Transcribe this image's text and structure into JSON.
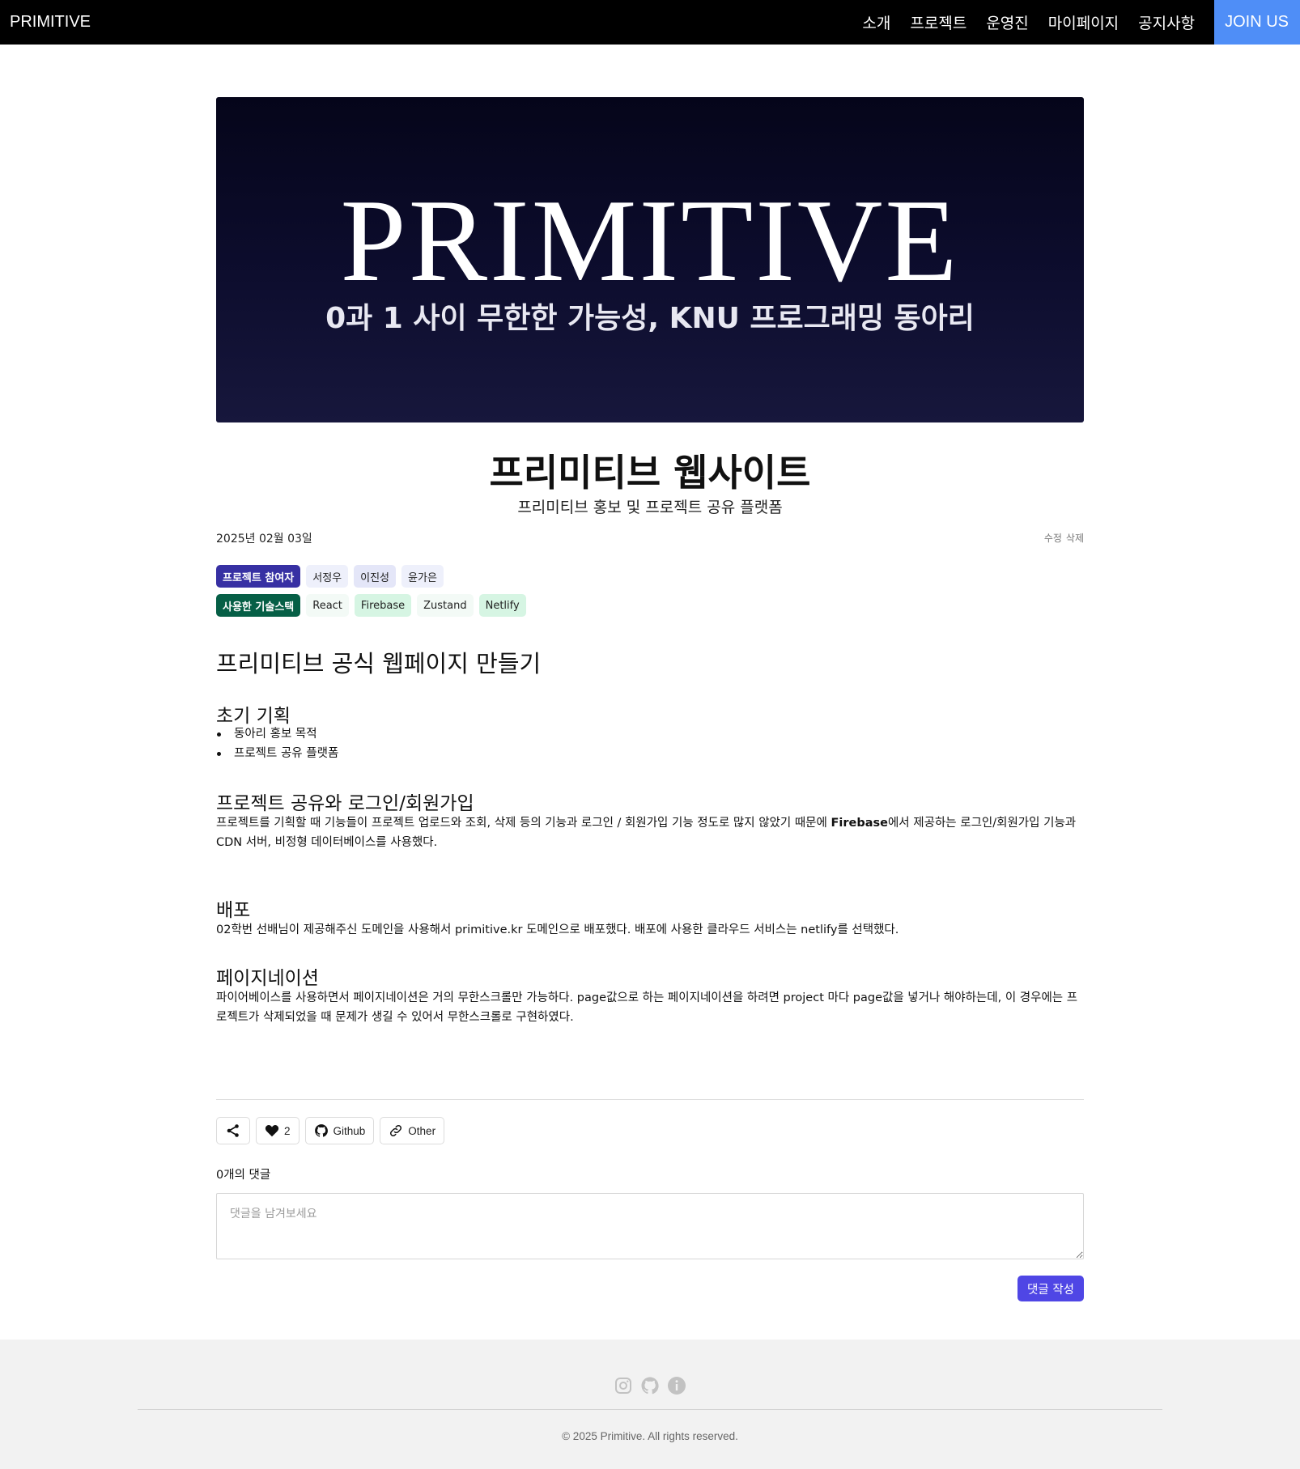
{
  "nav": {
    "brand": "PRIMITIVE",
    "items": [
      "소개",
      "프로젝트",
      "운영진",
      "마이페이지",
      "공지사항"
    ],
    "join_label": "JOIN US",
    "join_color": "#4f8ef7"
  },
  "hero": {
    "title": "PRIMITIVE",
    "subtitle": "0과 1 사이 무한한 가능성, KNU 프로그래밍 동아리"
  },
  "post": {
    "title": "프리미티브 웹사이트",
    "subtitle": "프리미티브 홍보 및 프로젝트 공유 플랫폼",
    "date": "2025년 02월 03일",
    "edit_label": "수정",
    "delete_label": "삭제"
  },
  "participants": {
    "header": "프로젝트 참여자",
    "names": [
      "서정우",
      "이진성",
      "윤가은"
    ]
  },
  "tech_stack": {
    "header": "사용한 기술스택",
    "items": [
      "React",
      "Firebase",
      "Zustand",
      "Netlify"
    ]
  },
  "content": {
    "h1": "프리미티브 공식 웹페이지 만들기",
    "s1_title": "초기 기획",
    "s1_bullets": [
      "동아리 홍보 목적",
      "프로젝트 공유 플랫폼"
    ],
    "s2_title": "프로젝트 공유와 로그인/회원가입",
    "s2_text_a": "프로젝트를 기획할 때 기능들이 프로젝트 업로드와 조회, 삭제 등의 기능과 로그인 / 회원가입 기능 정도로 많지 않았기 때문에 ",
    "s2_text_bold": "Firebase",
    "s2_text_b": "에서 제공하는 로그인/회원가입 기능과 CDN 서버, 비정형 데이터베이스를 사용했다.",
    "s3_title": "배포",
    "s3_text": "02학번 선배님이 제공해주신 도메인을 사용해서 primitive.kr 도메인으로 배포했다. 배포에 사용한 클라우드 서비스는 netlify를 선택했다.",
    "s4_title": "페이지네이션",
    "s4_text": "파이어베이스를 사용하면서 페이지네이션은 거의 무한스크롤만 가능하다. page값으로 하는 페이지네이션을 하려면 project 마다 page값을 넣거나 해야하는데, 이 경우에는 프로젝트가 삭제되었을 때 문제가 생길 수 있어서 무한스크롤로 구현하였다."
  },
  "buttons": {
    "share_icon": "share-icon",
    "like_icon": "heart-icon",
    "like_count": "2",
    "github_label": "Github",
    "other_label": "Other"
  },
  "comments": {
    "count_label": "0개의 댓글",
    "placeholder": "댓글을 남겨보세요",
    "value": "",
    "submit_label": "댓글 작성",
    "submit_color": "#4f46e5"
  },
  "footer": {
    "icons": [
      "instagram-icon",
      "github-icon",
      "info-icon"
    ],
    "copyright": "© 2025 Primitive. All rights reserved."
  }
}
